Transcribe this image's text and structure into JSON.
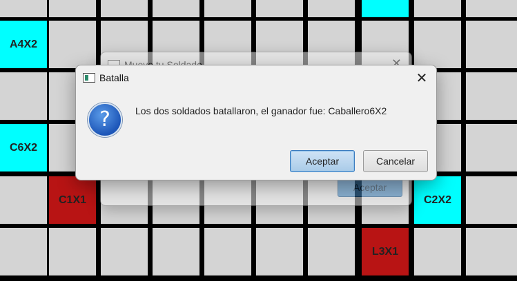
{
  "board": {
    "pieces": [
      {
        "label": "A4X2",
        "team": "cyan"
      },
      {
        "label": "C6X2",
        "team": "cyan"
      },
      {
        "label": "C1X1",
        "team": "red"
      },
      {
        "label": "C2X2",
        "team": "cyan"
      },
      {
        "label": "L3X1",
        "team": "red"
      }
    ],
    "colors": {
      "empty": "#d4d4d4",
      "cyan": "#00ffff",
      "red": "#b81414",
      "grid": "#000000"
    }
  },
  "back_dialog": {
    "title": "Mueve tu Soldado",
    "accept_label": "Aceptar"
  },
  "dialog": {
    "title": "Batalla",
    "message": "Los dos soldados batallaron, el ganador fue: Caballero6X2",
    "icon": "question-icon",
    "accept_label": "Aceptar",
    "cancel_label": "Cancelar"
  }
}
